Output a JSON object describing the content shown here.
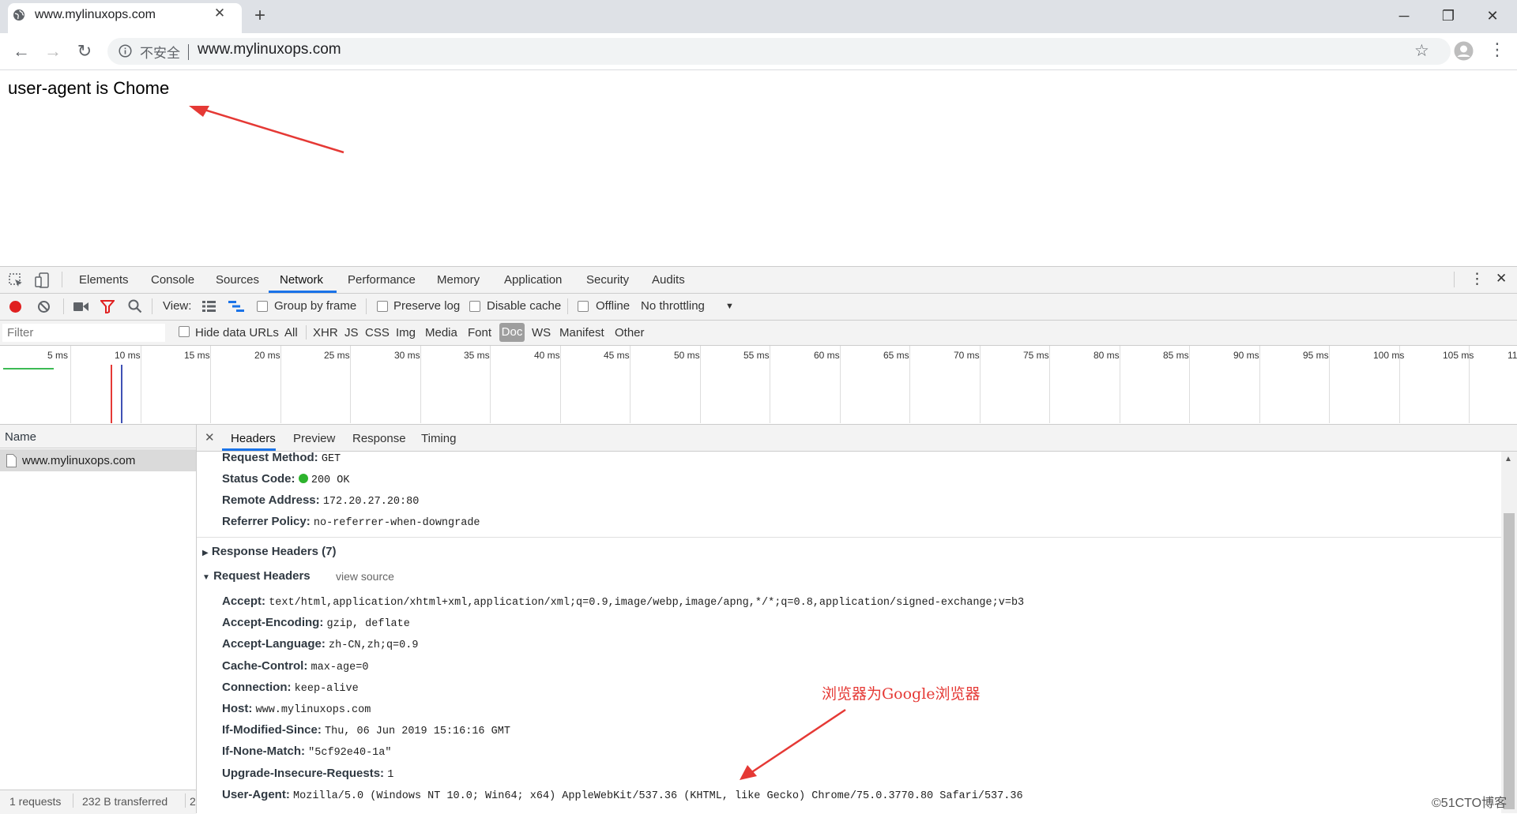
{
  "tab": {
    "title": "www.mylinuxops.com",
    "close": "✕",
    "new_tab": "+"
  },
  "window": {
    "minimize": "─",
    "restore": "❐",
    "close": "✕"
  },
  "toolbar": {
    "back": "←",
    "forward": "→",
    "reload": "↻",
    "security_text": "不安全",
    "url": "www.mylinuxops.com",
    "star": "☆",
    "menu": "⋮"
  },
  "page": {
    "text": "user-agent is Chome"
  },
  "devtools": {
    "tabs": [
      "Elements",
      "Console",
      "Sources",
      "Network",
      "Performance",
      "Memory",
      "Application",
      "Security",
      "Audits"
    ],
    "active_tab": "Network",
    "menu": "⋮",
    "close": "✕",
    "toolbar": {
      "view_label": "View:",
      "group_by_frame": "Group by frame",
      "preserve_log": "Preserve log",
      "disable_cache": "Disable cache",
      "offline": "Offline",
      "throttling": "No throttling",
      "dropdown": "▼"
    },
    "filter_bar": {
      "placeholder": "Filter",
      "hide_data_urls": "Hide data URLs",
      "types": [
        "All",
        "XHR",
        "JS",
        "CSS",
        "Img",
        "Media",
        "Font",
        "Doc",
        "WS",
        "Manifest",
        "Other"
      ],
      "selected_type": "Doc"
    },
    "timeline_ticks": [
      "5 ms",
      "10 ms",
      "15 ms",
      "20 ms",
      "25 ms",
      "30 ms",
      "35 ms",
      "40 ms",
      "45 ms",
      "50 ms",
      "55 ms",
      "60 ms",
      "65 ms",
      "70 ms",
      "75 ms",
      "80 ms",
      "85 ms",
      "90 ms",
      "95 ms",
      "100 ms",
      "105 ms",
      "11"
    ],
    "name_panel": {
      "header": "Name",
      "rows": [
        "www.mylinuxops.com"
      ]
    },
    "status_bar": {
      "requests": "1 requests",
      "transferred": "232 B transferred",
      "more": "2"
    },
    "detail_tabs": [
      "Headers",
      "Preview",
      "Response",
      "Timing"
    ],
    "detail_close": "✕",
    "general": [
      {
        "key": "Request Method:",
        "value": "GET"
      },
      {
        "key": "Status Code:",
        "value": "200 OK",
        "status_color": "#2db32d"
      },
      {
        "key": "Remote Address:",
        "value": "172.20.27.20:80"
      },
      {
        "key": "Referrer Policy:",
        "value": "no-referrer-when-downgrade"
      }
    ],
    "response_headers_title": "Response Headers (7)",
    "request_headers_title": "Request Headers",
    "view_source": "view source",
    "request_headers": [
      {
        "key": "Accept:",
        "value": "text/html,application/xhtml+xml,application/xml;q=0.9,image/webp,image/apng,*/*;q=0.8,application/signed-exchange;v=b3"
      },
      {
        "key": "Accept-Encoding:",
        "value": "gzip, deflate"
      },
      {
        "key": "Accept-Language:",
        "value": "zh-CN,zh;q=0.9"
      },
      {
        "key": "Cache-Control:",
        "value": "max-age=0"
      },
      {
        "key": "Connection:",
        "value": "keep-alive"
      },
      {
        "key": "Host:",
        "value": "www.mylinuxops.com"
      },
      {
        "key": "If-Modified-Since:",
        "value": "Thu, 06 Jun 2019 15:16:16 GMT"
      },
      {
        "key": "If-None-Match:",
        "value": "\"5cf92e40-1a\""
      },
      {
        "key": "Upgrade-Insecure-Requests:",
        "value": "1"
      },
      {
        "key": "User-Agent:",
        "value": "Mozilla/5.0 (Windows NT 10.0; Win64; x64) AppleWebKit/537.36 (KHTML, like Gecko) Chrome/75.0.3770.80 Safari/537.36"
      }
    ]
  },
  "annotation": {
    "text": "浏览器为Google浏览器",
    "color": "#e53935"
  },
  "watermark": "©51CTO博客"
}
